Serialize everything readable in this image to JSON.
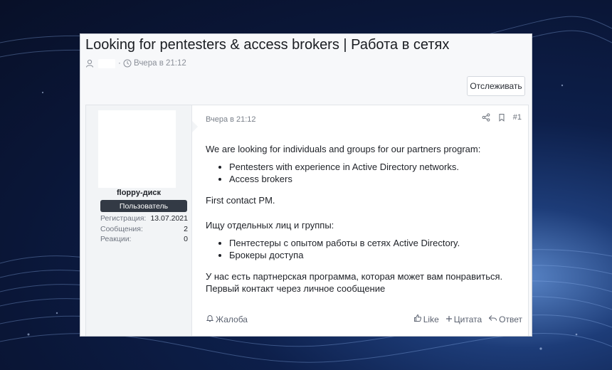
{
  "thread": {
    "title": "Looking for pentesters & access brokers | Работа в сетях",
    "date": "Вчера в 21:12",
    "follow_label": "Отслеживать"
  },
  "post": {
    "date": "Вчера в 21:12",
    "number": "#1",
    "user": {
      "name": "floppy-диск",
      "role": "Пользователь",
      "stats": [
        {
          "label": "Регистрация:",
          "value": "13.07.2021"
        },
        {
          "label": "Сообщения:",
          "value": "2"
        },
        {
          "label": "Реакции:",
          "value": "0"
        }
      ]
    },
    "body": {
      "intro_en": "We are looking for individuals and groups for our partners program:",
      "list_en": [
        "Pentesters with experience in Active Directory networks.",
        "Access brokers"
      ],
      "contact_en": "First contact PM.",
      "intro_ru": "Ищу отдельных лиц и группы:",
      "list_ru": [
        "Пентестеры с опытом работы в сетях Active Directory.",
        "Брокеры доступа"
      ],
      "closing_ru_1": "У нас есть партнерская программа, которая может вам понравиться.",
      "closing_ru_2": "Первый контакт через личное сообщение"
    },
    "actions": {
      "report": "Жалоба",
      "like": "Like",
      "quote": "Цитата",
      "reply": "Ответ"
    }
  },
  "icons": [
    "user-icon",
    "clock-icon",
    "share-icon",
    "bookmark-icon",
    "bell-icon",
    "thumbs-up-icon",
    "plus-icon",
    "reply-icon"
  ]
}
